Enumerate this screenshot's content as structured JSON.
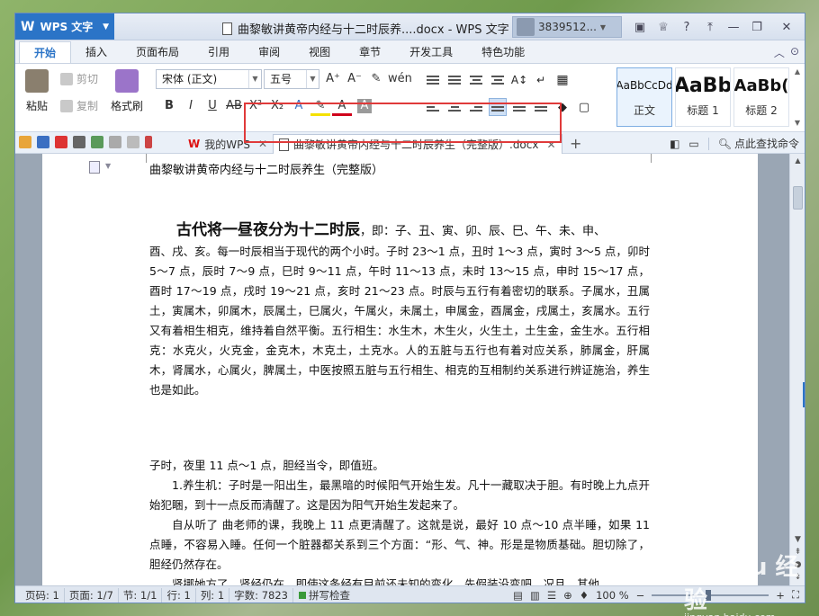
{
  "app": {
    "name": "WPS 文字",
    "window_title": "曲黎敏讲黄帝内经与十二时辰养....docx - WPS 文字",
    "user": "3839512..."
  },
  "menu": {
    "tabs": [
      "开始",
      "插入",
      "页面布局",
      "引用",
      "审阅",
      "视图",
      "章节",
      "开发工具",
      "特色功能"
    ]
  },
  "ribbon": {
    "paste": "粘贴",
    "cut": "剪切",
    "copy": "复制",
    "format_painter": "格式刷",
    "font_name": "宋体 (正文)",
    "font_size": "五号",
    "styles": [
      {
        "preview": "AaBbCcDd",
        "name": "正文"
      },
      {
        "preview": "AaBb",
        "name": "标题 1"
      },
      {
        "preview": "AaBb(",
        "name": "标题 2"
      }
    ]
  },
  "docbar": {
    "tab_home": "我的WPS",
    "tab_doc": "曲黎敏讲黄帝内经与十二时辰养生（完整版）.docx",
    "search": "点此查找命令"
  },
  "document": {
    "header": "曲黎敏讲黄帝内经与十二时辰养生（完整版）",
    "lead_bold": "古代将一昼夜分为十二时辰",
    "lead_rest": "，即：子、丑、寅、卯、辰、巳、午、未、申、",
    "p1": "酉、戌、亥。每一时辰相当于现代的两个小时。子时 23～1 点，丑时 1～3 点，寅时 3～5 点，卯时 5～7 点，辰时 7～9 点，巳时 9～11 点，午时 11～13 点，未时 13～15 点，申时 15～17 点，酉时 17～19 点，戌时 19～21 点，亥时 21～23 点。时辰与五行有着密切的联系。子属水，丑属土，寅属木，卯属木，辰属土，巳属火，午属火，未属土，申属金，酉属金，戌属土，亥属水。五行又有着相生相克，维持着自然平衡。五行相生：水生木，木生火，火生土，土生金，金生水。五行相克：水克火，火克金，金克木，木克土，土克水。人的五脏与五行也有着对应关系，肺属金，肝属木，肾属水，心属火，脾属土，中医按照五脏与五行相生、相克的互相制约关系进行辨证施治，养生也是如此。",
    "p2": "子时，夜里 11 点～1 点，胆经当令，即值班。",
    "p3": "1.养生机：子时是一阳出生，最黑暗的时候阳气开始生发。凡十一藏取决于胆。有时晚上九点开始犯睏，到十一点反而清醒了。这是因为阳气开始生发起来了。",
    "p4": "自从听了 曲老师的课，我晚上 11 点更清醒了。这就是说，最好 10 点～10 点半睡，如果 11 点睡，不容易入睡。任何一个脏器都关系到三个方面：“形、气、神。形是是物质基础。胆切除了，胆经仍然存在。",
    "p5": "肾挪她方了，肾经仍在，即使这条经有目前还未知的变化，先假装没变吧。况且，其他"
  },
  "status": {
    "page_num": "页码: 1",
    "page": "页面: 1/7",
    "section": "节: 1/1",
    "row": "行: 1",
    "col": "列: 1",
    "words": "字数: 7823",
    "spell": "拼写检查",
    "zoom": "100 %"
  },
  "colors": {
    "accent": "#2b74c7",
    "highlight": "#e03a3a"
  }
}
